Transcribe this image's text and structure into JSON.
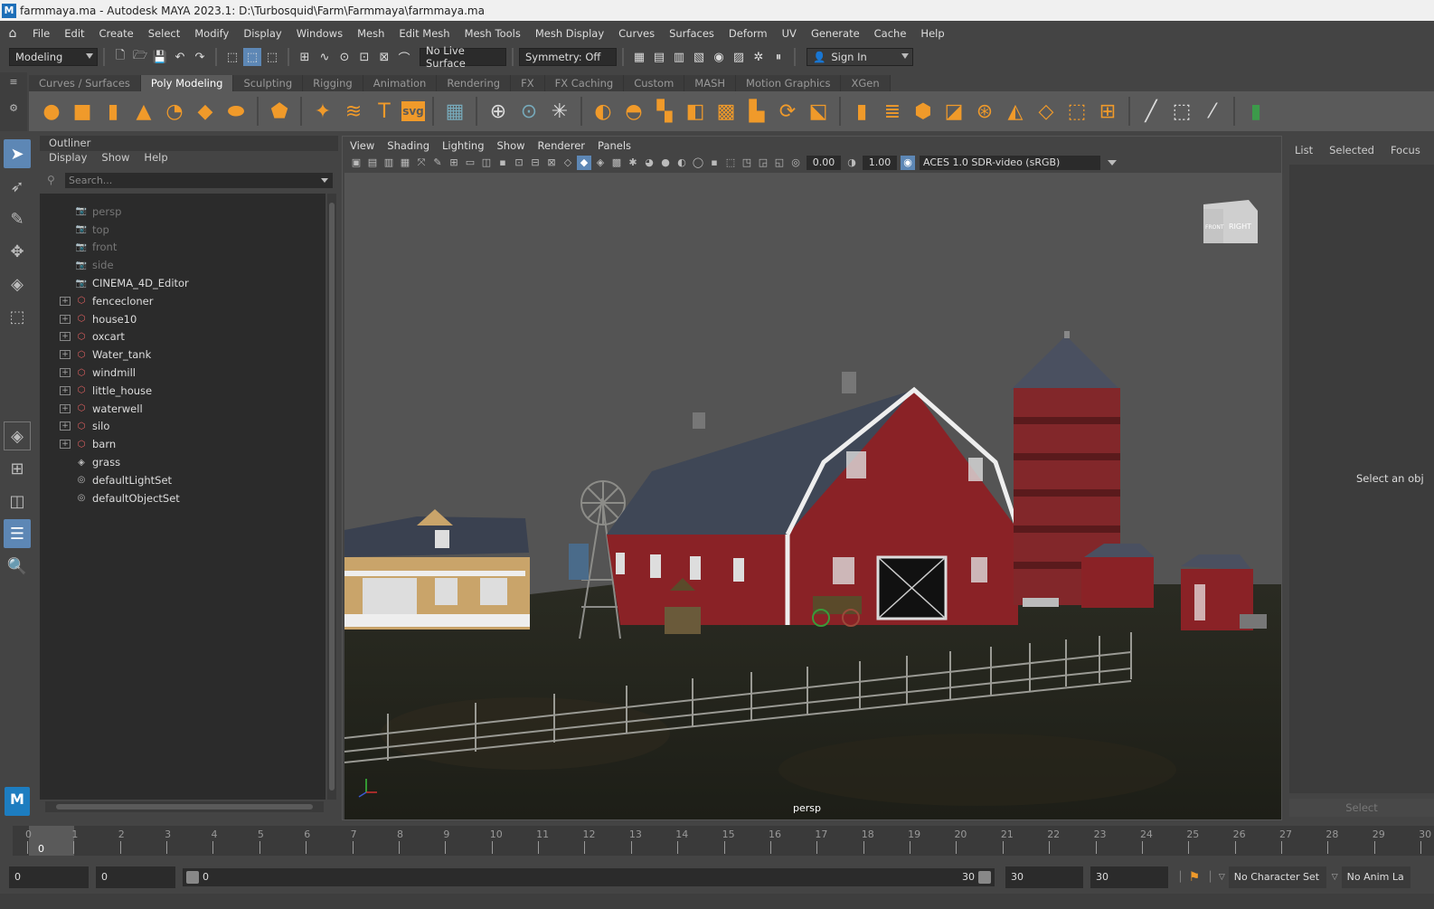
{
  "window": {
    "title": "farmmaya.ma - Autodesk MAYA 2023.1: D:\\Turbosquid\\Farm\\Farmmaya\\farmmaya.ma",
    "app_icon": "M"
  },
  "menubar": {
    "items": [
      "File",
      "Edit",
      "Create",
      "Select",
      "Modify",
      "Display",
      "Windows",
      "Mesh",
      "Edit Mesh",
      "Mesh Tools",
      "Mesh Display",
      "Curves",
      "Surfaces",
      "Deform",
      "UV",
      "Generate",
      "Cache",
      "Help"
    ]
  },
  "statusline": {
    "menuset": "Modeling",
    "live_surface": "No Live Surface",
    "symmetry": "Symmetry: Off",
    "sign_in": "Sign In"
  },
  "shelf": {
    "tabs": [
      "Curves / Surfaces",
      "Poly Modeling",
      "Sculpting",
      "Rigging",
      "Animation",
      "Rendering",
      "FX",
      "FX Caching",
      "Custom",
      "MASH",
      "Motion Graphics",
      "XGen"
    ],
    "active_tab": "Poly Modeling",
    "svg_label": "svg"
  },
  "outliner": {
    "title": "Outliner",
    "menu": [
      "Display",
      "Show",
      "Help"
    ],
    "search_placeholder": "Search...",
    "items": [
      {
        "label": "persp",
        "type": "camera",
        "dim": true,
        "expandable": false
      },
      {
        "label": "top",
        "type": "camera",
        "dim": true,
        "expandable": false
      },
      {
        "label": "front",
        "type": "camera",
        "dim": true,
        "expandable": false
      },
      {
        "label": "side",
        "type": "camera",
        "dim": true,
        "expandable": false
      },
      {
        "label": "CINEMA_4D_Editor",
        "type": "camera",
        "dim": false,
        "expandable": false
      },
      {
        "label": "fencecloner",
        "type": "group",
        "dim": false,
        "expandable": true
      },
      {
        "label": "house10",
        "type": "group",
        "dim": false,
        "expandable": true
      },
      {
        "label": "oxcart",
        "type": "group",
        "dim": false,
        "expandable": true
      },
      {
        "label": "Water_tank",
        "type": "group",
        "dim": false,
        "expandable": true
      },
      {
        "label": "windmill",
        "type": "group",
        "dim": false,
        "expandable": true
      },
      {
        "label": "little_house",
        "type": "group",
        "dim": false,
        "expandable": true
      },
      {
        "label": "waterwell",
        "type": "group",
        "dim": false,
        "expandable": true
      },
      {
        "label": "silo",
        "type": "group",
        "dim": false,
        "expandable": true
      },
      {
        "label": "barn",
        "type": "group",
        "dim": false,
        "expandable": true
      },
      {
        "label": "grass",
        "type": "mesh",
        "dim": false,
        "expandable": false
      },
      {
        "label": "defaultLightSet",
        "type": "set",
        "dim": false,
        "expandable": false
      },
      {
        "label": "defaultObjectSet",
        "type": "set",
        "dim": false,
        "expandable": false
      }
    ]
  },
  "viewport": {
    "menu": [
      "View",
      "Shading",
      "Lighting",
      "Show",
      "Renderer",
      "Panels"
    ],
    "exposure": "0.00",
    "gamma": "1.00",
    "color_space": "ACES 1.0 SDR-video (sRGB)",
    "camera_label": "persp",
    "viewcube_front": "FRONT",
    "viewcube_right": "RIGHT"
  },
  "right_panel": {
    "tabs": [
      "List",
      "Selected",
      "Focus"
    ],
    "message": "Select an obj",
    "select_button": "Select"
  },
  "timeslider": {
    "ticks": [
      "0",
      "1",
      "2",
      "3",
      "4",
      "5",
      "6",
      "7",
      "8",
      "9",
      "10",
      "11",
      "12",
      "13",
      "14",
      "15",
      "16",
      "17",
      "18",
      "19",
      "20",
      "21",
      "22",
      "23",
      "24",
      "25",
      "26",
      "27",
      "28",
      "29",
      "30"
    ],
    "current_frame": "0"
  },
  "range": {
    "start": "0",
    "anim_start": "0",
    "slider_start": "0",
    "slider_end": "30",
    "anim_end": "30",
    "end": "30",
    "character_set": "No Character Set",
    "anim_layer": "No Anim La"
  },
  "colors": {
    "barn_red": "#8a2226",
    "silo_red": "#82272a",
    "roof": "#4a5060",
    "accent_orange": "#f09a2a",
    "active_tab": "#5a5a5a"
  }
}
